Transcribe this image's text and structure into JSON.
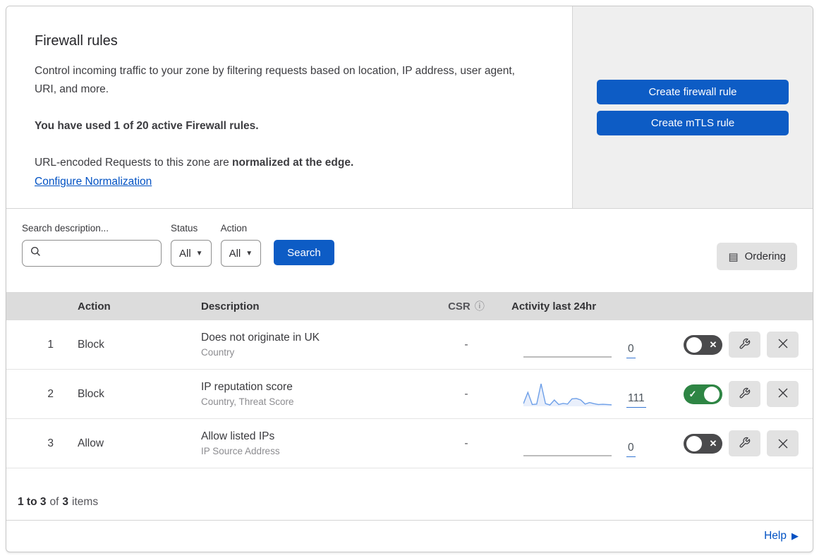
{
  "header": {
    "title": "Firewall rules",
    "description": "Control incoming traffic to your zone by filtering requests based on location, IP address, user agent, URI, and more.",
    "usage_note": "You have used 1 of 20 active Firewall rules.",
    "normalization_prefix": "URL-encoded Requests to this zone are ",
    "normalization_bold": "normalized at the edge.",
    "normalization_link": "Configure Normalization",
    "buttons": {
      "create_firewall_rule": "Create firewall rule",
      "create_mtls_rule": "Create mTLS rule"
    }
  },
  "filters": {
    "search_label": "Search description...",
    "status_label": "Status",
    "status_value": "All",
    "action_label": "Action",
    "action_value": "All",
    "search_button": "Search",
    "ordering_button": "Ordering"
  },
  "icons": {
    "info": "ⓘ",
    "ordering": "▤",
    "dropdown_arrow": "▼",
    "help_arrow": "▶",
    "check": "✓",
    "cross": "✕"
  },
  "table": {
    "columns": {
      "action": "Action",
      "description": "Description",
      "csr": "CSR",
      "activity": "Activity last 24hr"
    },
    "rows": [
      {
        "number": "1",
        "action": "Block",
        "description": "Does not originate in UK",
        "criteria": "Country",
        "csr": "-",
        "count": "0",
        "enabled": false,
        "spark": {
          "values": [
            0,
            0,
            0,
            0,
            0,
            0,
            0,
            0,
            0,
            0,
            0,
            0,
            0,
            0,
            0,
            0,
            0,
            0,
            0,
            0,
            0
          ],
          "color": "#a5a5a5",
          "fill": null
        }
      },
      {
        "number": "2",
        "action": "Block",
        "description": "IP reputation score",
        "criteria": "Country, Threat Score",
        "csr": "-",
        "count": "111",
        "enabled": true,
        "spark": {
          "values": [
            0.12,
            0.62,
            0.08,
            0.1,
            1.0,
            0.12,
            0.06,
            0.28,
            0.08,
            0.13,
            0.1,
            0.33,
            0.35,
            0.28,
            0.1,
            0.17,
            0.12,
            0.08,
            0.09,
            0.08,
            0.07
          ],
          "color": "#6d9fe8",
          "fill": "#e9effb"
        }
      },
      {
        "number": "3",
        "action": "Allow",
        "description": "Allow listed IPs",
        "criteria": "IP Source Address",
        "csr": "-",
        "count": "0",
        "enabled": false,
        "spark": {
          "values": [
            0,
            0,
            0,
            0,
            0,
            0,
            0,
            0,
            0,
            0,
            0,
            0,
            0,
            0,
            0,
            0,
            0,
            0,
            0,
            0,
            0
          ],
          "color": "#a5a5a5",
          "fill": null
        }
      }
    ]
  },
  "footer": {
    "range": "1 to 3",
    "of_text": "of",
    "total": "3",
    "items_text": "items"
  },
  "help": {
    "label": "Help"
  },
  "colors": {
    "primary_blue": "#0d5cc5",
    "link_blue": "#0051c3",
    "toggle_on_green": "#2e8544",
    "toggle_off_gray": "#4a4a4c",
    "spark_blue": "#6d9fe8",
    "table_header_gray": "#dcdcdc",
    "panel_gray": "#efefef"
  }
}
